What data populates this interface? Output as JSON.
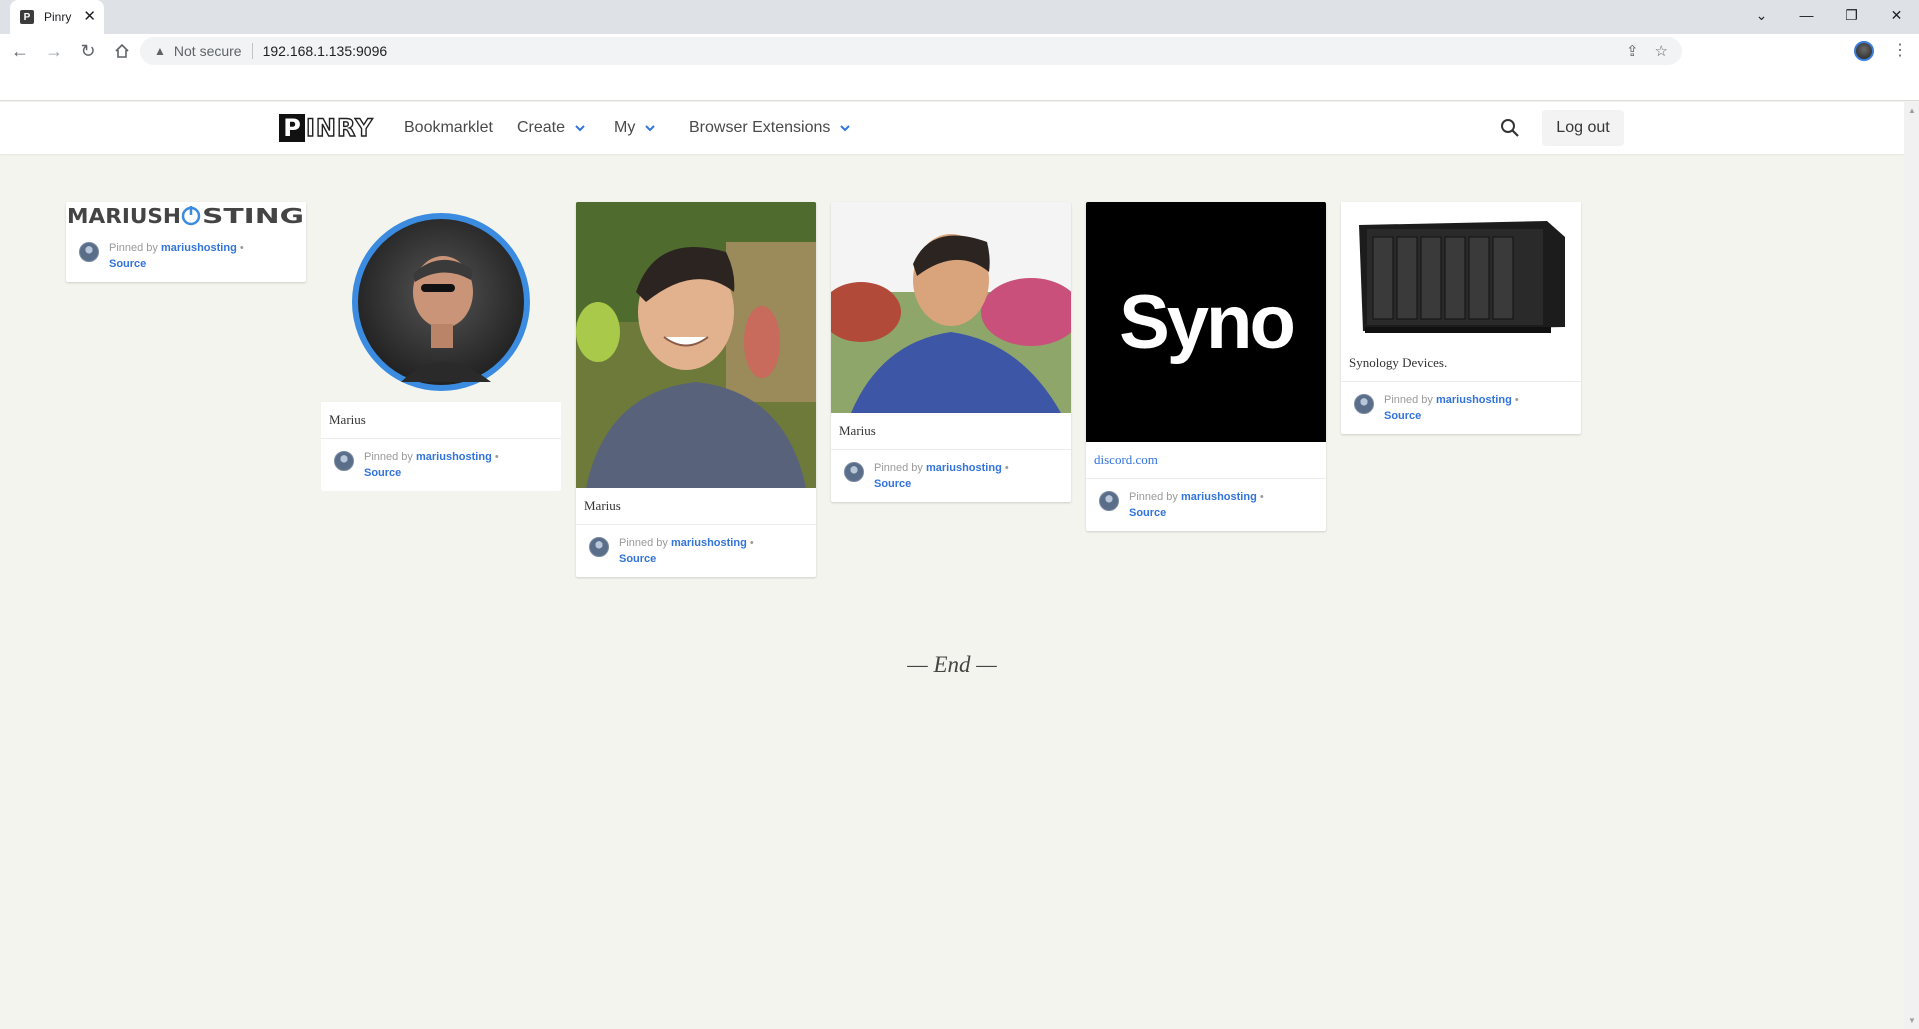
{
  "browser": {
    "tab_title": "Pinry",
    "tab_favicon": "P",
    "security_label": "Not secure",
    "url": "192.168.1.135:9096"
  },
  "nav": {
    "logo_first": "P",
    "logo_rest": "INRY",
    "bookmarklet": "Bookmarklet",
    "create": "Create",
    "my": "My",
    "browser_extensions": "Browser Extensions",
    "logout": "Log out"
  },
  "colors": {
    "accent": "#3273dc",
    "background": "#f4f4ee"
  },
  "pins": [
    {
      "description": "",
      "pinned_by_label": "Pinned by",
      "user": "mariushosting",
      "separator": "•",
      "source": "Source",
      "logo_text_a": "MARIUSH",
      "logo_text_b": "STING"
    },
    {
      "description": "Marius",
      "pinned_by_label": "Pinned by",
      "user": "mariushosting",
      "separator": "•",
      "source": "Source"
    },
    {
      "description": "Marius",
      "pinned_by_label": "Pinned by",
      "user": "mariushosting",
      "separator": "•",
      "source": "Source"
    },
    {
      "description": "Marius",
      "pinned_by_label": "Pinned by",
      "user": "mariushosting",
      "separator": "•",
      "source": "Source"
    },
    {
      "description": "discord.com",
      "pinned_by_label": "Pinned by",
      "user": "mariushosting",
      "separator": "•",
      "source": "Source",
      "image_text": "Syno"
    },
    {
      "description": "Synology Devices.",
      "pinned_by_label": "Pinned by",
      "user": "mariushosting",
      "separator": "•",
      "source": "Source"
    }
  ],
  "end_text": "— End —"
}
